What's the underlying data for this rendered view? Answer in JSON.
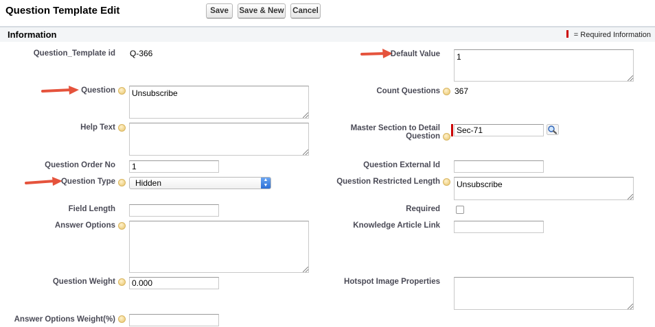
{
  "header": {
    "title": "Question Template Edit",
    "buttons": {
      "save": "Save",
      "save_new": "Save & New",
      "cancel": "Cancel"
    }
  },
  "section": {
    "title": "Information",
    "required_legend": "= Required Information"
  },
  "left": {
    "template_id": {
      "label": "Question_Template id",
      "value": "Q-366"
    },
    "question": {
      "label": "Question",
      "value": "Unsubscribe"
    },
    "help_text": {
      "label": "Help Text",
      "value": ""
    },
    "order_no": {
      "label": "Question Order No",
      "value": "1"
    },
    "question_type": {
      "label": "Question Type",
      "value": "Hidden"
    },
    "field_length": {
      "label": "Field Length",
      "value": ""
    },
    "answer_options": {
      "label": "Answer Options",
      "value": ""
    },
    "question_weight": {
      "label": "Question Weight",
      "value": "0.000"
    },
    "answer_options_weight": {
      "label": "Answer Options Weight(%)",
      "value": ""
    }
  },
  "right": {
    "default_value": {
      "label": "Default Value",
      "value": "1"
    },
    "count_questions": {
      "label": "Count Questions",
      "value": "367"
    },
    "master_section": {
      "label_line1": "Master Section to Detail",
      "label_line2": "Question",
      "value": "Sec-71"
    },
    "external_id": {
      "label": "Question External Id",
      "value": ""
    },
    "restricted_length": {
      "label": "Question Restricted Length",
      "value": "Unsubscribe"
    },
    "required": {
      "label": "Required",
      "checked": false
    },
    "knowledge_link": {
      "label": "Knowledge Article Link",
      "value": ""
    },
    "hotspot": {
      "label": "Hotspot Image Properties",
      "value": ""
    }
  },
  "colors": {
    "required": "#cc0000",
    "annotation_arrow": "#e5533c",
    "section_bg": "#f3f5f7"
  },
  "icons": [
    "help-icon",
    "lookup-icon",
    "select-arrow-icon",
    "annotation-arrow-icon"
  ]
}
